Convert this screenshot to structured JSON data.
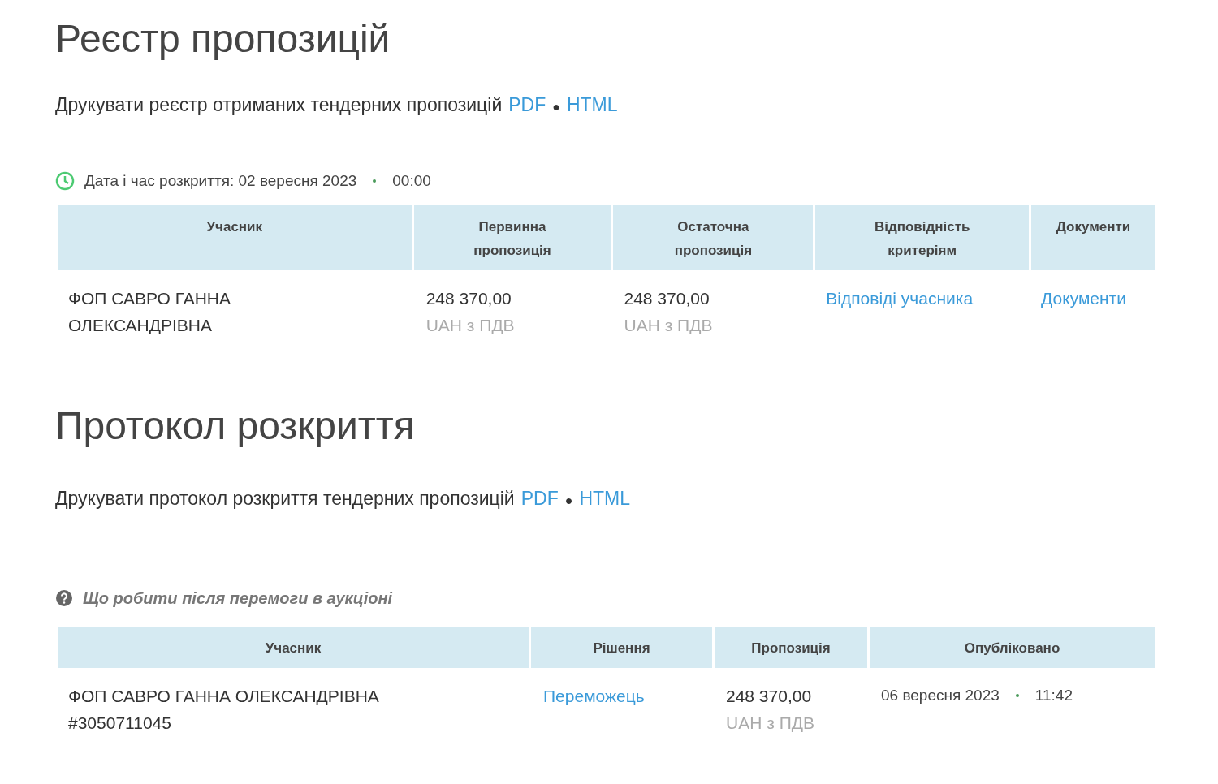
{
  "registry": {
    "title": "Реєстр пропозицій",
    "print_label": "Друкувати реєстр отриманих тендерних пропозицій",
    "links": [
      "PDF",
      "HTML"
    ],
    "separator": "●",
    "opening": {
      "label": "Дата і час розкриття: 02 вересня 2023",
      "time": "00:00"
    },
    "columns": [
      "Учасник",
      "Первинна пропозиція",
      "Остаточна пропозиція",
      "Відповідність критеріям",
      "Документи"
    ],
    "rows": [
      {
        "participant": "ФОП САВРО ГАННА ОЛЕКСАНДРІВНА",
        "initial_amount": "248 370,00",
        "initial_currency": "UAH з ПДВ",
        "final_amount": "248 370,00",
        "final_currency": "UAH з ПДВ",
        "criteria_link": "Відповіді учасника",
        "documents_link": "Документи"
      }
    ]
  },
  "protocol": {
    "title": "Протокол розкриття",
    "print_label": "Друкувати протокол розкриття тендерних пропозицій",
    "links": [
      "PDF",
      "HTML"
    ],
    "separator": "●",
    "help": "Що робити після перемоги в аукціоні",
    "columns": [
      "Учасник",
      "Рішення",
      "Пропозиція",
      "Опубліковано"
    ],
    "rows": [
      {
        "participant": "ФОП САВРО ГАННА ОЛЕКСАНДРІВНА",
        "participant_id": "#3050711045",
        "decision": "Переможець",
        "amount": "248 370,00",
        "currency": "UAH з ПДВ",
        "date": "06 вересня 2023",
        "time": "11:42"
      }
    ]
  }
}
